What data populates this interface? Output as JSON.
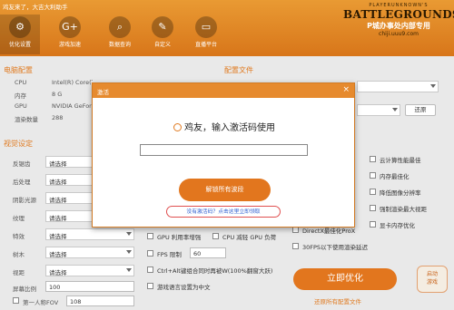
{
  "window": {
    "title": "鸡友来了，大吉大利助手"
  },
  "toolbar": [
    {
      "label": "优化设置",
      "icon": "gear-icon",
      "glyph": "⚙"
    },
    {
      "label": "游戏加速",
      "icon": "gplus-icon",
      "glyph": "G+"
    },
    {
      "label": "数据查询",
      "icon": "search-icon",
      "glyph": "⌕"
    },
    {
      "label": "自定义",
      "icon": "palette-icon",
      "glyph": "✎"
    },
    {
      "label": "直播平台",
      "icon": "tv-icon",
      "glyph": "▭"
    }
  ],
  "banner": {
    "line1": "PLAYERUNKNOWN'S",
    "line2": "BATTLEGROUNDS",
    "line3": "P城办事处内部专用",
    "line4": "chiji.uuu9.com"
  },
  "pc_config": {
    "title": "电脑配置",
    "rows": [
      {
        "label": "CPU",
        "value": "Intel(R) Core(TM) i5-3470 CPU @ 3.20GHz"
      },
      {
        "label": "内存",
        "value": "8 G"
      },
      {
        "label": "GPU",
        "value": "NVIDIA GeForce"
      },
      {
        "label": "渲染数量",
        "value": "288"
      }
    ]
  },
  "config_file": {
    "title": "配置文件",
    "restore_label": "还原"
  },
  "visual": {
    "title": "视觉设定",
    "rows": [
      {
        "label": "反锯齿",
        "value": "请选择"
      },
      {
        "label": "后处理",
        "value": "请选择"
      },
      {
        "label": "阴影光源",
        "value": "请选择"
      },
      {
        "label": "纹理",
        "value": "请选择"
      },
      {
        "label": "特效",
        "value": "请选择"
      },
      {
        "label": "树木",
        "value": "请选择"
      },
      {
        "label": "视距",
        "value": "请选择"
      }
    ],
    "screen_ratio": {
      "label": "屏幕比例",
      "value": "100"
    },
    "fov": {
      "label": "第一人称FOV",
      "value": "108"
    }
  },
  "middle_options": {
    "gpu_util": "GPU 利用率增强",
    "cpu_gpu": "CPU 减轻 GPU 负荷",
    "fps_limit": "FPS 限制",
    "fps_value": "60",
    "ctrl_alt": "Ctrl+Alt键组合同时再被W(100%翻窗大跃)",
    "chinese_ui": "游戏语言设置为中文"
  },
  "right_options": [
    "云计算性能最佳",
    "内存最佳化",
    "降低图像分辨率",
    "强制渲染最大视距",
    "显卡内存优化",
    "DirectX最佳化ProX",
    "30FPS以下使用渲染延迟"
  ],
  "modal": {
    "header": "激活",
    "title": "鸡友，输入激活码使用",
    "input_value": "",
    "unlock_label": "解锁所有波段",
    "get_code_link": "没有激活码？点击这里立即领取"
  },
  "bottom": {
    "optimize_label": "立即优化",
    "restore_all": "还原所有配置文件",
    "auto_game_line1": "启动",
    "auto_game_line2": "游戏"
  },
  "colors": {
    "accent": "#e2761e",
    "link": "#2f5fd0"
  }
}
